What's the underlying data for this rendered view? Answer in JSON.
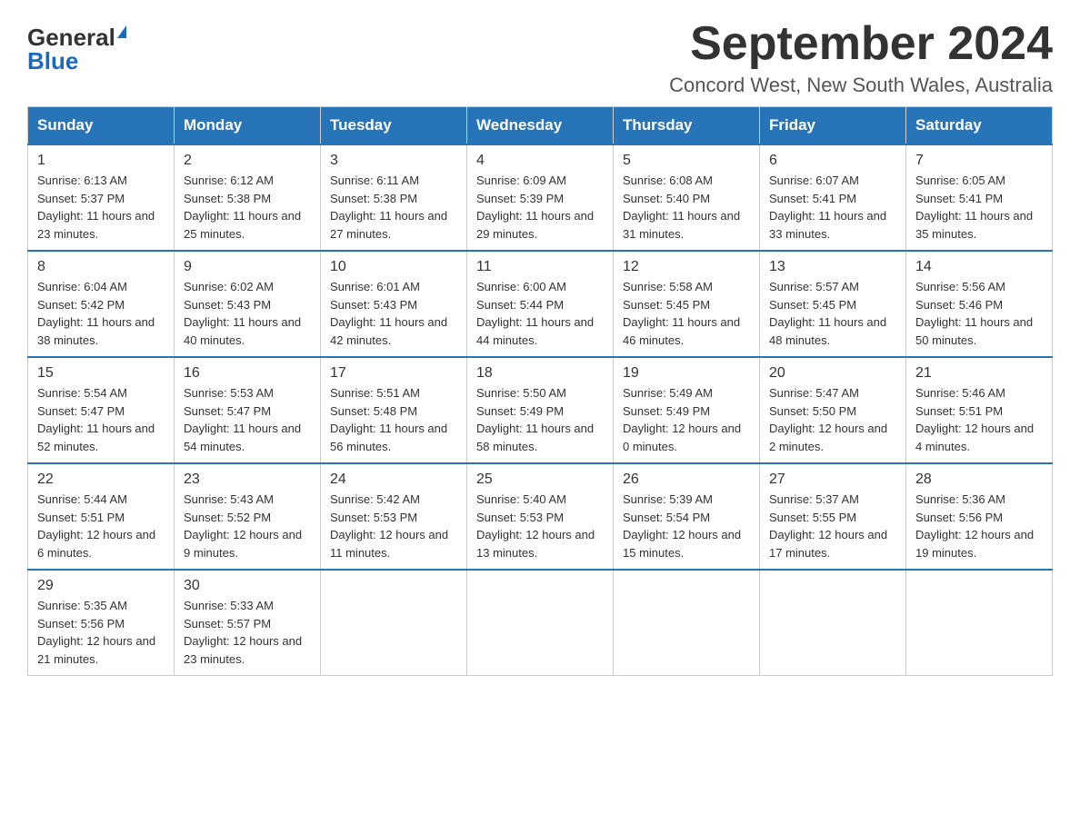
{
  "header": {
    "logo_general": "General",
    "logo_blue": "Blue",
    "month_title": "September 2024",
    "location": "Concord West, New South Wales, Australia"
  },
  "weekdays": [
    "Sunday",
    "Monday",
    "Tuesday",
    "Wednesday",
    "Thursday",
    "Friday",
    "Saturday"
  ],
  "weeks": [
    [
      {
        "day": "1",
        "sunrise": "6:13 AM",
        "sunset": "5:37 PM",
        "daylight": "11 hours and 23 minutes."
      },
      {
        "day": "2",
        "sunrise": "6:12 AM",
        "sunset": "5:38 PM",
        "daylight": "11 hours and 25 minutes."
      },
      {
        "day": "3",
        "sunrise": "6:11 AM",
        "sunset": "5:38 PM",
        "daylight": "11 hours and 27 minutes."
      },
      {
        "day": "4",
        "sunrise": "6:09 AM",
        "sunset": "5:39 PM",
        "daylight": "11 hours and 29 minutes."
      },
      {
        "day": "5",
        "sunrise": "6:08 AM",
        "sunset": "5:40 PM",
        "daylight": "11 hours and 31 minutes."
      },
      {
        "day": "6",
        "sunrise": "6:07 AM",
        "sunset": "5:41 PM",
        "daylight": "11 hours and 33 minutes."
      },
      {
        "day": "7",
        "sunrise": "6:05 AM",
        "sunset": "5:41 PM",
        "daylight": "11 hours and 35 minutes."
      }
    ],
    [
      {
        "day": "8",
        "sunrise": "6:04 AM",
        "sunset": "5:42 PM",
        "daylight": "11 hours and 38 minutes."
      },
      {
        "day": "9",
        "sunrise": "6:02 AM",
        "sunset": "5:43 PM",
        "daylight": "11 hours and 40 minutes."
      },
      {
        "day": "10",
        "sunrise": "6:01 AM",
        "sunset": "5:43 PM",
        "daylight": "11 hours and 42 minutes."
      },
      {
        "day": "11",
        "sunrise": "6:00 AM",
        "sunset": "5:44 PM",
        "daylight": "11 hours and 44 minutes."
      },
      {
        "day": "12",
        "sunrise": "5:58 AM",
        "sunset": "5:45 PM",
        "daylight": "11 hours and 46 minutes."
      },
      {
        "day": "13",
        "sunrise": "5:57 AM",
        "sunset": "5:45 PM",
        "daylight": "11 hours and 48 minutes."
      },
      {
        "day": "14",
        "sunrise": "5:56 AM",
        "sunset": "5:46 PM",
        "daylight": "11 hours and 50 minutes."
      }
    ],
    [
      {
        "day": "15",
        "sunrise": "5:54 AM",
        "sunset": "5:47 PM",
        "daylight": "11 hours and 52 minutes."
      },
      {
        "day": "16",
        "sunrise": "5:53 AM",
        "sunset": "5:47 PM",
        "daylight": "11 hours and 54 minutes."
      },
      {
        "day": "17",
        "sunrise": "5:51 AM",
        "sunset": "5:48 PM",
        "daylight": "11 hours and 56 minutes."
      },
      {
        "day": "18",
        "sunrise": "5:50 AM",
        "sunset": "5:49 PM",
        "daylight": "11 hours and 58 minutes."
      },
      {
        "day": "19",
        "sunrise": "5:49 AM",
        "sunset": "5:49 PM",
        "daylight": "12 hours and 0 minutes."
      },
      {
        "day": "20",
        "sunrise": "5:47 AM",
        "sunset": "5:50 PM",
        "daylight": "12 hours and 2 minutes."
      },
      {
        "day": "21",
        "sunrise": "5:46 AM",
        "sunset": "5:51 PM",
        "daylight": "12 hours and 4 minutes."
      }
    ],
    [
      {
        "day": "22",
        "sunrise": "5:44 AM",
        "sunset": "5:51 PM",
        "daylight": "12 hours and 6 minutes."
      },
      {
        "day": "23",
        "sunrise": "5:43 AM",
        "sunset": "5:52 PM",
        "daylight": "12 hours and 9 minutes."
      },
      {
        "day": "24",
        "sunrise": "5:42 AM",
        "sunset": "5:53 PM",
        "daylight": "12 hours and 11 minutes."
      },
      {
        "day": "25",
        "sunrise": "5:40 AM",
        "sunset": "5:53 PM",
        "daylight": "12 hours and 13 minutes."
      },
      {
        "day": "26",
        "sunrise": "5:39 AM",
        "sunset": "5:54 PM",
        "daylight": "12 hours and 15 minutes."
      },
      {
        "day": "27",
        "sunrise": "5:37 AM",
        "sunset": "5:55 PM",
        "daylight": "12 hours and 17 minutes."
      },
      {
        "day": "28",
        "sunrise": "5:36 AM",
        "sunset": "5:56 PM",
        "daylight": "12 hours and 19 minutes."
      }
    ],
    [
      {
        "day": "29",
        "sunrise": "5:35 AM",
        "sunset": "5:56 PM",
        "daylight": "12 hours and 21 minutes."
      },
      {
        "day": "30",
        "sunrise": "5:33 AM",
        "sunset": "5:57 PM",
        "daylight": "12 hours and 23 minutes."
      },
      null,
      null,
      null,
      null,
      null
    ]
  ],
  "labels": {
    "sunrise": "Sunrise: ",
    "sunset": "Sunset: ",
    "daylight": "Daylight: "
  }
}
